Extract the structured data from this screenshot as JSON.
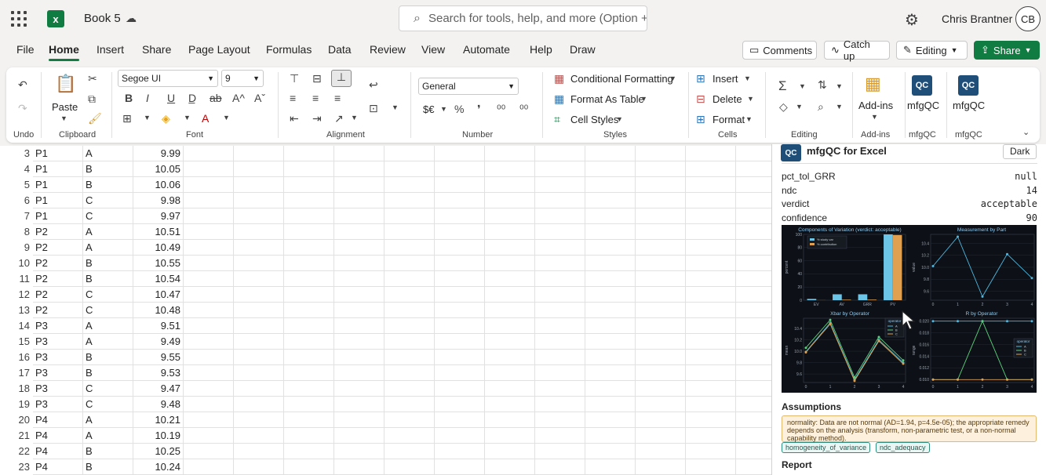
{
  "app": {
    "doc_title": "Book 5",
    "search_placeholder": "Search for tools, help, and more (Option + Q)",
    "user_name": "Chris Brantner",
    "user_initials": "CB",
    "brand_color": "#107c41"
  },
  "menu": [
    "File",
    "Home",
    "Insert",
    "Share",
    "Page Layout",
    "Formulas",
    "Data",
    "Review",
    "View",
    "Automate",
    "Help",
    "Draw"
  ],
  "header_buttons": {
    "comments": "Comments",
    "catch_up": "Catch up",
    "editing": "Editing",
    "share": "Share"
  },
  "ribbon": {
    "undo_label": "Undo",
    "paste_label": "Paste",
    "clipboard_label": "Clipboard",
    "font_name": "Segoe UI",
    "font_size": "9",
    "font_label": "Font",
    "alignment_label": "Alignment",
    "number_format": "General",
    "number_symbols": "$€",
    "number_label": "Number",
    "conditional_formatting": "Conditional Formatting",
    "format_as_table": "Format As Table",
    "cell_styles": "Cell Styles",
    "styles_label": "Styles",
    "insert": "Insert",
    "delete": "Delete",
    "format": "Format",
    "cells_label": "Cells",
    "editing_label": "Editing",
    "addins": "Add-ins",
    "addins_label": "Add-ins",
    "mfgqc1": "mfgQC",
    "mfgqc1_group": "mfgQC",
    "mfgqc2": "mfgQC",
    "mfgqc2_group": "mfgQC",
    "qc_icon_text": "QC"
  },
  "rows": [
    {
      "n": "3",
      "part": "P1",
      "op": "A",
      "val": "9.99"
    },
    {
      "n": "4",
      "part": "P1",
      "op": "B",
      "val": "10.05"
    },
    {
      "n": "5",
      "part": "P1",
      "op": "B",
      "val": "10.06"
    },
    {
      "n": "6",
      "part": "P1",
      "op": "C",
      "val": "9.98"
    },
    {
      "n": "7",
      "part": "P1",
      "op": "C",
      "val": "9.97"
    },
    {
      "n": "8",
      "part": "P2",
      "op": "A",
      "val": "10.51"
    },
    {
      "n": "9",
      "part": "P2",
      "op": "A",
      "val": "10.49"
    },
    {
      "n": "10",
      "part": "P2",
      "op": "B",
      "val": "10.55"
    },
    {
      "n": "11",
      "part": "P2",
      "op": "B",
      "val": "10.54"
    },
    {
      "n": "12",
      "part": "P2",
      "op": "C",
      "val": "10.47"
    },
    {
      "n": "13",
      "part": "P2",
      "op": "C",
      "val": "10.48"
    },
    {
      "n": "14",
      "part": "P3",
      "op": "A",
      "val": "9.51"
    },
    {
      "n": "15",
      "part": "P3",
      "op": "A",
      "val": "9.49"
    },
    {
      "n": "16",
      "part": "P3",
      "op": "B",
      "val": "9.55"
    },
    {
      "n": "17",
      "part": "P3",
      "op": "B",
      "val": "9.53"
    },
    {
      "n": "18",
      "part": "P3",
      "op": "C",
      "val": "9.47"
    },
    {
      "n": "19",
      "part": "P3",
      "op": "C",
      "val": "9.48"
    },
    {
      "n": "20",
      "part": "P4",
      "op": "A",
      "val": "10.21"
    },
    {
      "n": "21",
      "part": "P4",
      "op": "A",
      "val": "10.19"
    },
    {
      "n": "22",
      "part": "P4",
      "op": "B",
      "val": "10.25"
    },
    {
      "n": "23",
      "part": "P4",
      "op": "B",
      "val": "10.24"
    }
  ],
  "pane": {
    "title": "mfgQC for Excel",
    "logo_text": "QC",
    "dark_button": "Dark",
    "metrics": [
      {
        "k": "pct_tol_GRR",
        "v": "null"
      },
      {
        "k": "ndc",
        "v": "14"
      },
      {
        "k": "verdict",
        "v": "acceptable"
      },
      {
        "k": "confidence",
        "v": "90"
      }
    ],
    "assumptions_title": "Assumptions",
    "assumption_text": "normality: Data are not normal (AD=1.94, p=4.5e-05); the appropriate remedy depends on the analysis (transform, non-parametric test, or a non-normal capability method).",
    "tags": [
      "homogeneity_of_variance",
      "ndc_adequacy"
    ],
    "report_title": "Report"
  },
  "chart_data": [
    {
      "type": "bar",
      "title": "Components of Variation  (verdict: acceptable)",
      "categories": [
        "EV",
        "AV",
        "GRR",
        "PV"
      ],
      "series": [
        {
          "name": "% study var",
          "values": [
            2,
            9,
            9,
            100
          ],
          "color": "#6cc4e6"
        },
        {
          "name": "% contribution",
          "values": [
            0.1,
            0.8,
            0.9,
            99
          ],
          "color": "#e0a050"
        }
      ],
      "ylabel": "percent",
      "ylim": [
        0,
        100
      ],
      "yticks": [
        0,
        20,
        40,
        60,
        80,
        100
      ]
    },
    {
      "type": "line",
      "title": "Measurement by Part",
      "x": [
        0,
        1,
        2,
        3,
        4
      ],
      "values": [
        10.02,
        10.51,
        9.51,
        10.22,
        9.82
      ],
      "ylabel": "value",
      "ylim": [
        9.45,
        10.55
      ],
      "yticks": [
        9.6,
        9.8,
        10.0,
        10.2,
        10.4
      ],
      "color": "#4fb8e0"
    },
    {
      "type": "line",
      "title": "Xbar by Operator",
      "x": [
        0,
        1,
        2,
        3,
        4
      ],
      "series": [
        {
          "name": "A",
          "values": [
            9.99,
            10.5,
            9.5,
            10.2,
            9.8
          ],
          "color": "#4fb8e0"
        },
        {
          "name": "B",
          "values": [
            10.06,
            10.55,
            9.54,
            10.25,
            9.84
          ],
          "color": "#5ad07a"
        },
        {
          "name": "C",
          "values": [
            9.98,
            10.48,
            9.48,
            10.18,
            9.78
          ],
          "color": "#e0a050"
        }
      ],
      "legend_title": "operator",
      "ylabel": "mean",
      "ylim": [
        9.45,
        10.58
      ],
      "yticks": [
        9.6,
        9.8,
        10.0,
        10.2,
        10.4
      ],
      "xticks": [
        "0",
        "1",
        "2",
        "3",
        "4"
      ]
    },
    {
      "type": "line",
      "title": "R by Operator",
      "x": [
        0,
        1,
        2,
        3,
        4
      ],
      "series": [
        {
          "name": "A",
          "values": [
            0.02,
            0.02,
            0.02,
            0.02,
            0.02
          ],
          "color": "#4fb8e0"
        },
        {
          "name": "B",
          "values": [
            0.01,
            0.01,
            0.02,
            0.01,
            0.01
          ],
          "color": "#5ad07a"
        },
        {
          "name": "C",
          "values": [
            0.01,
            0.01,
            0.01,
            0.01,
            0.01
          ],
          "color": "#e0a050"
        }
      ],
      "legend_title": "operator",
      "ylabel": "range",
      "ylim": [
        0.0095,
        0.0205
      ],
      "yticks": [
        0.01,
        0.012,
        0.014,
        0.016,
        0.018,
        0.02
      ],
      "xticks": [
        "0",
        "1",
        "2",
        "3",
        "4"
      ]
    }
  ]
}
